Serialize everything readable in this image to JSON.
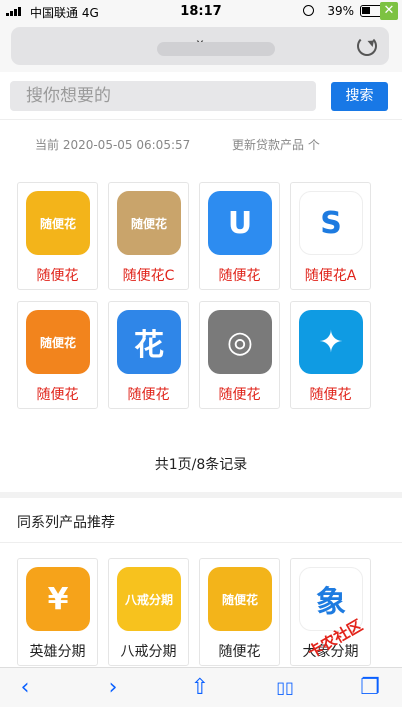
{
  "status": {
    "carrier": "中国联通  4G",
    "time": "18:17",
    "battery": "39%"
  },
  "browser": {
    "url": "x"
  },
  "search": {
    "placeholder": "搜你想要的",
    "button": "搜索"
  },
  "meta": {
    "current": "当前 2020-05-05 06:05:57",
    "updated": "更新贷款产品 个"
  },
  "products": [
    {
      "name": "随便花",
      "color": "#f3b41a",
      "glyph": "随便花"
    },
    {
      "name": "随便花C",
      "color": "#c9a46b",
      "glyph": "随便花"
    },
    {
      "name": "随便花",
      "color": "#2d8cf0",
      "glyph": "U"
    },
    {
      "name": "随便花A",
      "color": "#ffffff",
      "glyph": "S"
    },
    {
      "name": "随便花",
      "color": "#f2841d",
      "glyph": "随便花"
    },
    {
      "name": "随便花",
      "color": "#2f86e8",
      "glyph": "花"
    },
    {
      "name": "随便花",
      "color": "#7a7a7a",
      "glyph": "◎"
    },
    {
      "name": "随便花",
      "color": "#0f9be3",
      "glyph": "✦"
    }
  ],
  "paging": "共1页/8条记录",
  "related": {
    "title": "同系列产品推荐",
    "items": [
      {
        "name": "英雄分期",
        "color": "#f6a31a",
        "glyph": "¥"
      },
      {
        "name": "八戒分期",
        "color": "#f7c21e",
        "glyph": "八戒分期"
      },
      {
        "name": "随便花",
        "color": "#f3b41a",
        "glyph": "随便花"
      },
      {
        "name": "大象分期",
        "color": "#ffffff",
        "glyph": "象"
      }
    ]
  },
  "watermark": "卡农社区",
  "toolbar": {
    "back": "‹",
    "forward": "›",
    "share": "⇧",
    "bookmarks": "▯▯",
    "tabs": "❐"
  }
}
